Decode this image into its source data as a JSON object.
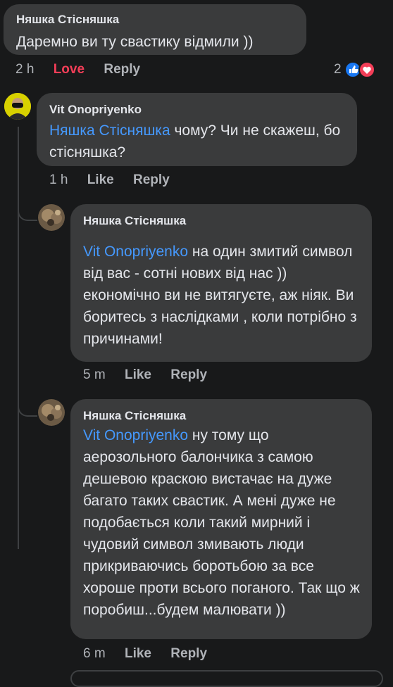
{
  "comments": [
    {
      "author": "Няшка Стісняшка",
      "text": "Даремно ви ту свастику відмили ))",
      "time": "2 h",
      "reaction_label": "Love",
      "reply_label": "Reply",
      "reaction_count": "2"
    },
    {
      "author": "Vit Onopriyenko",
      "mention": "Няшка Стісняшка",
      "text": " чому? Чи не скажеш, бо стісняшка?",
      "time": "1 h",
      "like_label": "Like",
      "reply_label": "Reply"
    },
    {
      "author": "Няшка Стісняшка",
      "mention": "Vit Onopriyenko",
      "text": " на один змитий символ від вас - сотні нових від нас )) економічно ви не витягуєте, аж ніяк. Ви боритесь з наслідками , коли потрібно з причинами!",
      "time": "5 m",
      "like_label": "Like",
      "reply_label": "Reply"
    },
    {
      "author": "Няшка Стісняшка",
      "mention": "Vit Onopriyenko",
      "text": " ну тому що аерозольного балончика з самою дешевою краскою вистачає на дуже багато таких свастик. А мені дуже не подобається коли такий мирний і чудовий символ змивають люди прикриваючись боротьбою за все хороше проти всього поганого. Так що ж поробиш...будем малювати ))",
      "time": "6 m",
      "like_label": "Like",
      "reply_label": "Reply"
    }
  ],
  "colors": {
    "background": "#18191a",
    "bubble": "#3a3b3c",
    "mention": "#4599ff",
    "love": "#f33e58",
    "like_icon": "#1877f2"
  }
}
